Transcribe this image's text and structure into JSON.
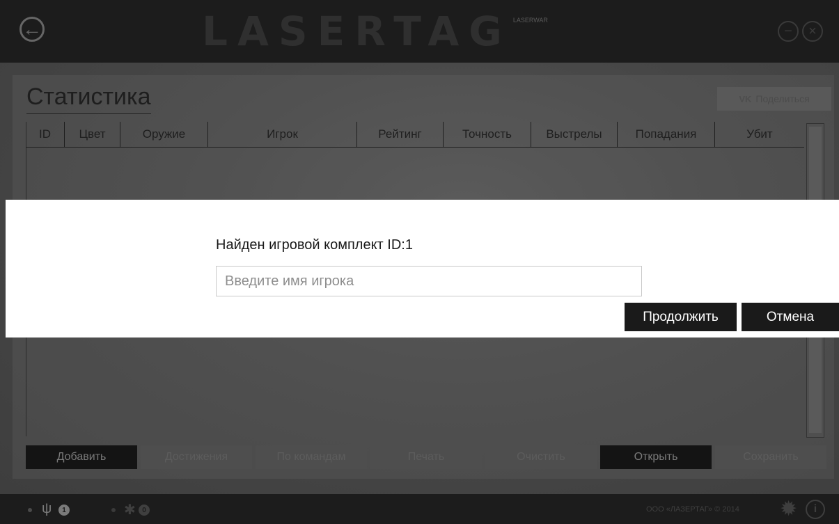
{
  "header": {
    "logo_text": "LASERTAG",
    "logo_sub": "LASERWAR",
    "back_icon": "←",
    "minimize_icon": "−",
    "close_icon": "×"
  },
  "stats": {
    "title": "Статистика",
    "share_vk": "VK",
    "share_label": "Поделиться",
    "columns": [
      "ID",
      "Цвет",
      "Оружие",
      "Игрок",
      "Рейтинг",
      "Точность",
      "Выстрелы",
      "Попадания",
      "Убит"
    ]
  },
  "buttons": {
    "add": "Добавить",
    "achievements": "Достижения",
    "by_team": "По командам",
    "print": "Печать",
    "clear": "Очистить",
    "open": "Открыть",
    "save": "Сохранить"
  },
  "footer": {
    "usb_icon": "ψ",
    "usb_count": "1",
    "bt_icon": "✱",
    "bt_count": "0",
    "copyright": "ООО «ЛАЗЕРТАГ» © 2014",
    "gear_icon": "✹",
    "info_icon": "i"
  },
  "dialog": {
    "message": "Найден игровой комплект ID:1",
    "input_value": "",
    "input_placeholder": "Введите имя игрока",
    "continue_label": "Продолжить",
    "cancel_label": "Отмена"
  }
}
